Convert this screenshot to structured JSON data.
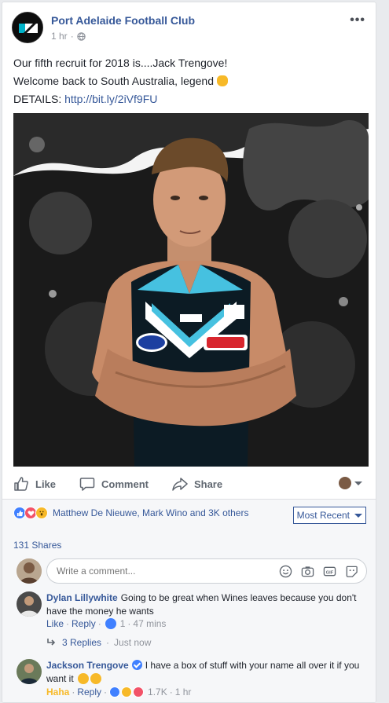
{
  "post": {
    "page_name": "Port Adelaide Football Club",
    "time": "1 hr",
    "more_icon": "more-dots-icon",
    "lines": [
      "Our fifth recruit for 2018 is....Jack Trengove!",
      "Welcome back to South Australia, legend"
    ],
    "details_label": "DETAILS:",
    "details_link": "http://bit.ly/2iVf9FU"
  },
  "actions": {
    "like": "Like",
    "comment": "Comment",
    "share": "Share"
  },
  "reactions": {
    "summary": "Matthew De Nieuwe, Mark Wino and 3K others",
    "sort_label": "Most Recent",
    "shares": "131 Shares"
  },
  "composer": {
    "placeholder": "Write a comment..."
  },
  "comments": [
    {
      "name": "Dylan Lillywhite",
      "text": "Going to be great when Wines leaves because you don't have the money he wants",
      "like": "Like",
      "reply": "Reply",
      "like_count": "1",
      "time": "47 mins",
      "replies": "3 Replies",
      "replies_time": "Just now"
    },
    {
      "name": "Jackson Trengove",
      "text": "I have a box of stuff with your name all over it if you want it",
      "reaction_label": "Haha",
      "reply": "Reply",
      "count": "1.7K",
      "time": "1 hr"
    }
  ],
  "colors": {
    "link": "#365899",
    "like_blue": "#4080ff",
    "muted": "#90949c",
    "haha": "#f7b928"
  }
}
